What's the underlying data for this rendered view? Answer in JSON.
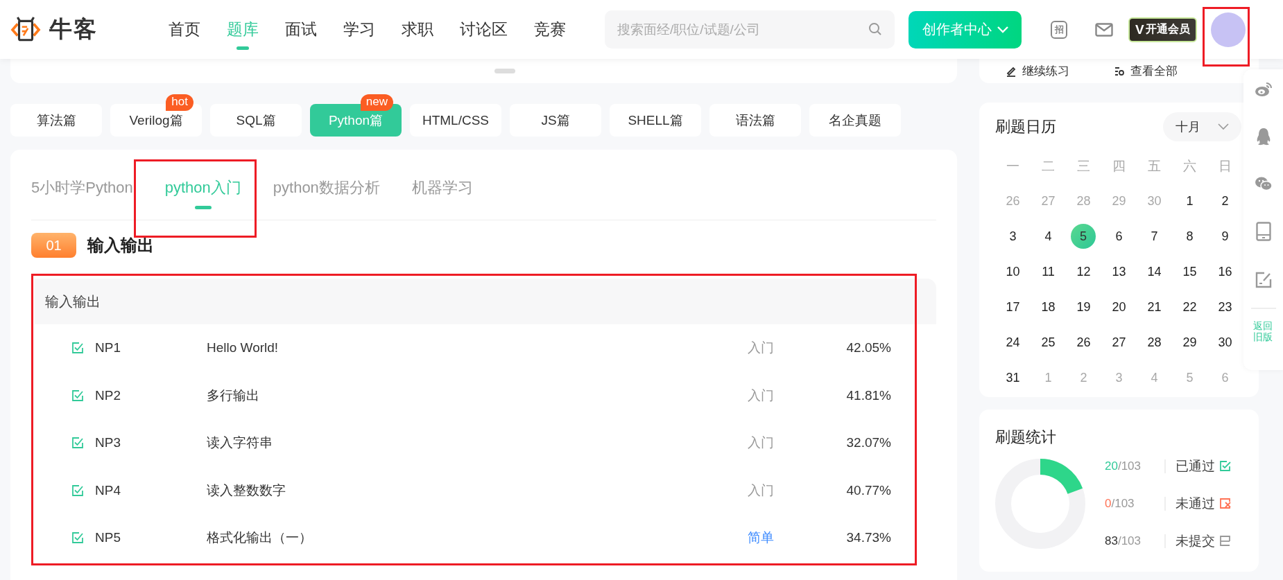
{
  "header": {
    "logo": "牛客",
    "nav": [
      {
        "label": "首页",
        "selected": false
      },
      {
        "label": "题库",
        "selected": true
      },
      {
        "label": "面试",
        "selected": false
      },
      {
        "label": "学习",
        "selected": false
      },
      {
        "label": "求职",
        "selected": false
      },
      {
        "label": "讨论区",
        "selected": false
      },
      {
        "label": "竞赛",
        "selected": false
      }
    ],
    "search": {
      "placeholder": "搜索面经/职位/试题/公司"
    },
    "creator_button": "创作者中心",
    "recruit_icon": "招",
    "vip": {
      "mark": "V",
      "label": "开通会员"
    },
    "avatar": {
      "highlighted": true
    }
  },
  "top_strip": {
    "links": [
      "继续练习",
      "查看全部"
    ]
  },
  "categories": [
    {
      "label": "算法篇",
      "selected": false
    },
    {
      "label": "Verilog篇",
      "selected": false,
      "badge": "hot"
    },
    {
      "label": "SQL篇",
      "selected": false
    },
    {
      "label": "Python篇",
      "selected": true,
      "badge": "new"
    },
    {
      "label": "HTML/CSS",
      "selected": false
    },
    {
      "label": "JS篇",
      "selected": false
    },
    {
      "label": "SHELL篇",
      "selected": false
    },
    {
      "label": "语法篇",
      "selected": false
    },
    {
      "label": "名企真题",
      "selected": false
    }
  ],
  "subtabs": [
    {
      "label": "5小时学Python",
      "selected": false,
      "highlighted": false
    },
    {
      "label": "python入门",
      "selected": true,
      "highlighted": true
    },
    {
      "label": "python数据分析",
      "selected": false,
      "highlighted": false
    },
    {
      "label": "机器学习",
      "selected": false,
      "highlighted": false
    }
  ],
  "section": {
    "number": "01",
    "title": "输入输出"
  },
  "problem_group": {
    "title": "输入输出",
    "highlighted": true,
    "rows": [
      {
        "id": "NP1",
        "title": "Hello World!",
        "difficulty": "入门",
        "color": "#999999",
        "pass_rate": "42.05%",
        "solved": true
      },
      {
        "id": "NP2",
        "title": "多行输出",
        "difficulty": "入门",
        "color": "#999999",
        "pass_rate": "41.81%",
        "solved": true
      },
      {
        "id": "NP3",
        "title": "读入字符串",
        "difficulty": "入门",
        "color": "#999999",
        "pass_rate": "32.07%",
        "solved": true
      },
      {
        "id": "NP4",
        "title": "读入整数数字",
        "difficulty": "入门",
        "color": "#999999",
        "pass_rate": "40.77%",
        "solved": true
      },
      {
        "id": "NP5",
        "title": "格式化输出（一）",
        "difficulty": "简单",
        "color": "#3f8cff",
        "pass_rate": "34.73%",
        "solved": true
      }
    ]
  },
  "calendar": {
    "title": "刷题日历",
    "month": "十月",
    "weekdays": [
      "一",
      "二",
      "三",
      "四",
      "五",
      "六",
      "日"
    ],
    "days": [
      {
        "label": "26",
        "in_month": false,
        "selected": false
      },
      {
        "label": "27",
        "in_month": false,
        "selected": false
      },
      {
        "label": "28",
        "in_month": false,
        "selected": false
      },
      {
        "label": "29",
        "in_month": false,
        "selected": false
      },
      {
        "label": "30",
        "in_month": false,
        "selected": false
      },
      {
        "label": "1",
        "in_month": true,
        "selected": false
      },
      {
        "label": "2",
        "in_month": true,
        "selected": false
      },
      {
        "label": "3",
        "in_month": true,
        "selected": false
      },
      {
        "label": "4",
        "in_month": true,
        "selected": false
      },
      {
        "label": "5",
        "in_month": true,
        "selected": true
      },
      {
        "label": "6",
        "in_month": true,
        "selected": false
      },
      {
        "label": "7",
        "in_month": true,
        "selected": false
      },
      {
        "label": "8",
        "in_month": true,
        "selected": false
      },
      {
        "label": "9",
        "in_month": true,
        "selected": false
      },
      {
        "label": "10",
        "in_month": true,
        "selected": false
      },
      {
        "label": "11",
        "in_month": true,
        "selected": false
      },
      {
        "label": "12",
        "in_month": true,
        "selected": false
      },
      {
        "label": "13",
        "in_month": true,
        "selected": false
      },
      {
        "label": "14",
        "in_month": true,
        "selected": false
      },
      {
        "label": "15",
        "in_month": true,
        "selected": false
      },
      {
        "label": "16",
        "in_month": true,
        "selected": false
      },
      {
        "label": "17",
        "in_month": true,
        "selected": false
      },
      {
        "label": "18",
        "in_month": true,
        "selected": false
      },
      {
        "label": "19",
        "in_month": true,
        "selected": false
      },
      {
        "label": "20",
        "in_month": true,
        "selected": false
      },
      {
        "label": "21",
        "in_month": true,
        "selected": false
      },
      {
        "label": "22",
        "in_month": true,
        "selected": false
      },
      {
        "label": "23",
        "in_month": true,
        "selected": false
      },
      {
        "label": "24",
        "in_month": true,
        "selected": false
      },
      {
        "label": "25",
        "in_month": true,
        "selected": false
      },
      {
        "label": "26",
        "in_month": true,
        "selected": false
      },
      {
        "label": "27",
        "in_month": true,
        "selected": false
      },
      {
        "label": "28",
        "in_month": true,
        "selected": false
      },
      {
        "label": "29",
        "in_month": true,
        "selected": false
      },
      {
        "label": "30",
        "in_month": true,
        "selected": false
      },
      {
        "label": "31",
        "in_month": true,
        "selected": false
      },
      {
        "label": "1",
        "in_month": false,
        "selected": false
      },
      {
        "label": "2",
        "in_month": false,
        "selected": false
      },
      {
        "label": "3",
        "in_month": false,
        "selected": false
      },
      {
        "label": "4",
        "in_month": false,
        "selected": false
      },
      {
        "label": "5",
        "in_month": false,
        "selected": false
      },
      {
        "label": "6",
        "in_month": false,
        "selected": false
      }
    ]
  },
  "stats": {
    "title": "刷题统计",
    "progress": {
      "level": 0.194
    },
    "items": [
      {
        "kind": "passed",
        "count": "20",
        "total": "/103",
        "label": "已通过"
      },
      {
        "kind": "failed",
        "count": "0",
        "total": "/103",
        "label": "未通过"
      },
      {
        "kind": "unsubmitted",
        "count": "83",
        "total": "/103",
        "label": "未提交"
      }
    ]
  },
  "side_bar": {
    "return_label": "返回旧版"
  }
}
